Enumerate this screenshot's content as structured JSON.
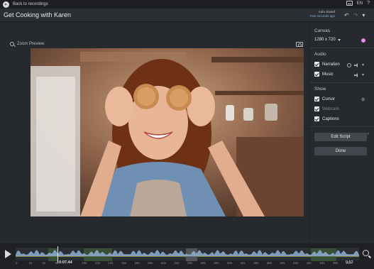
{
  "topbar": {
    "back_label": "Back to recordings",
    "language": "EN",
    "help": "?"
  },
  "titlebar": {
    "title": "Get Cooking with Karen",
    "autosave_line1": "Auto Saved",
    "autosave_line2": "Few seconds ago"
  },
  "preview": {
    "zoom_label": "Zoom Preview"
  },
  "panel": {
    "canvas_label": "Canvas",
    "resolution": "1280 x 720",
    "audio_label": "Audio",
    "narration": "Narration",
    "music": "Music",
    "show_label": "Show",
    "cursor": "Cursor",
    "webcam": "Webcam",
    "captions": "Captions",
    "edit_script": "Edit Script",
    "done": "Done",
    "accent_color": "#e88be6"
  },
  "timeline": {
    "current_time": "0:07.44",
    "end_time": "0:52",
    "ticks": [
      "0",
      "2s",
      "4s",
      "6s",
      "8s",
      "10s",
      "12s",
      "14s",
      "16s",
      "18s",
      "20s",
      "22s",
      "24s",
      "26s",
      "28s",
      "30s",
      "32s",
      "34s",
      "36s",
      "38s",
      "40s",
      "42s",
      "44s",
      "46s",
      "48s",
      "50s"
    ],
    "progress": 0.143
  }
}
